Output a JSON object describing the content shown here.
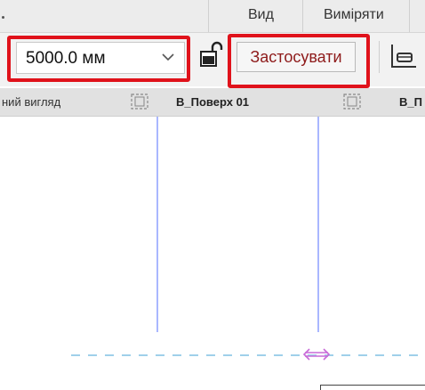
{
  "menu": {
    "items": [
      {
        "label": "Вид"
      },
      {
        "label": "Виміряти"
      }
    ]
  },
  "toolbar": {
    "offset_dropdown": {
      "value": "5000.0 мм"
    },
    "apply_label": "Застосувати"
  },
  "views": {
    "left_label": "ний вигляд",
    "level_name": "В_Поверх 01",
    "next_name": "В_П"
  },
  "colors": {
    "highlight": "#e0121b",
    "grid_line": "#a9b7ff",
    "dashed_line": "#9fd0ea",
    "dimension_arrow": "#c86ad8"
  }
}
